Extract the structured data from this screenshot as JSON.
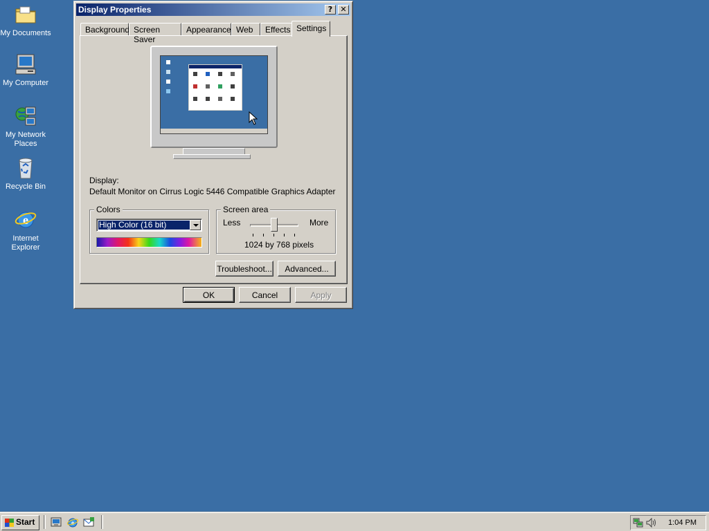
{
  "desktop": {
    "icons": [
      {
        "label": "My Documents",
        "icon": "folder-icon"
      },
      {
        "label": "My Computer",
        "icon": "computer-icon"
      },
      {
        "label": "My Network Places",
        "icon": "network-icon"
      },
      {
        "label": "Recycle Bin",
        "icon": "recycle-bin-icon"
      },
      {
        "label": "Internet Explorer",
        "icon": "ie-icon"
      }
    ]
  },
  "window": {
    "title": "Display Properties",
    "help_button": "?",
    "close_button": "✕",
    "tabs": [
      "Background",
      "Screen Saver",
      "Appearance",
      "Web",
      "Effects",
      "Settings"
    ],
    "active_tab": "Settings",
    "display_label": "Display:",
    "display_value": "Default Monitor on Cirrus Logic 5446 Compatible Graphics Adapter",
    "colors": {
      "group_title": "Colors",
      "selected": "High Color (16 bit)"
    },
    "screen_area": {
      "group_title": "Screen area",
      "less_label": "Less",
      "more_label": "More",
      "resolution_text": "1024 by 768 pixels",
      "slider_position": 0.5
    },
    "troubleshoot_button": "Troubleshoot...",
    "advanced_button": "Advanced...",
    "ok_button": "OK",
    "cancel_button": "Cancel",
    "apply_button": "Apply"
  },
  "taskbar": {
    "start_label": "Start",
    "quick_launch": [
      "show-desktop-icon",
      "ie-icon",
      "outlook-express-icon"
    ],
    "clock": "1:04 PM"
  },
  "colors": {
    "desktop": "#3a6ea5",
    "face": "#d4d0c8",
    "title_start": "#0a246a",
    "title_end": "#a6caf0"
  }
}
